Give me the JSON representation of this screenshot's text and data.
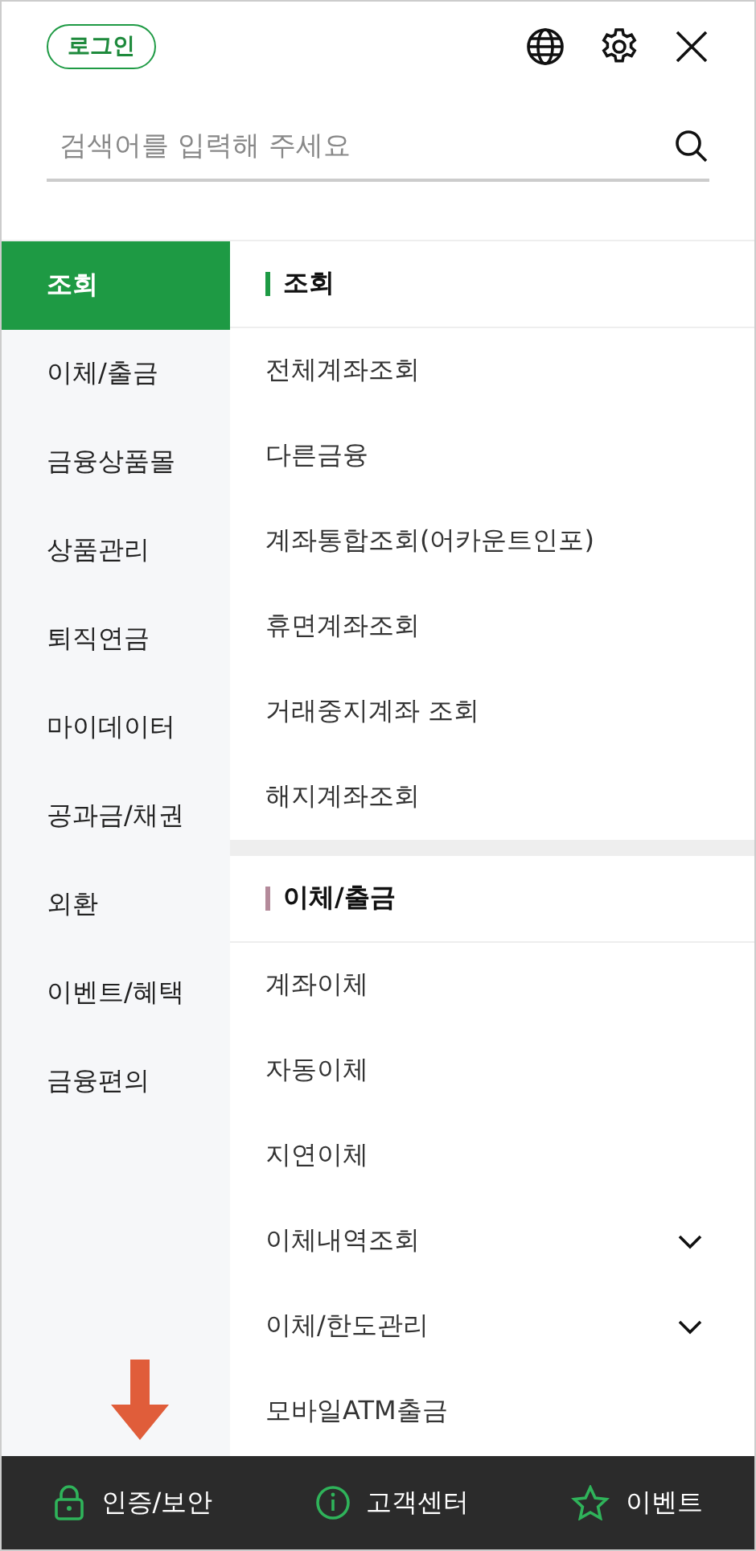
{
  "header": {
    "login_button": "로그인"
  },
  "search": {
    "placeholder": "검색어를 입력해 주세요"
  },
  "sidebar": {
    "items": [
      {
        "label": "조회",
        "selected": true
      },
      {
        "label": "이체/출금",
        "selected": false
      },
      {
        "label": "금융상품몰",
        "selected": false
      },
      {
        "label": "상품관리",
        "selected": false
      },
      {
        "label": "퇴직연금",
        "selected": false
      },
      {
        "label": "마이데이터",
        "selected": false
      },
      {
        "label": "공과금/채권",
        "selected": false
      },
      {
        "label": "외환",
        "selected": false
      },
      {
        "label": "이벤트/혜택",
        "selected": false
      },
      {
        "label": "금융편의",
        "selected": false
      }
    ]
  },
  "sections": [
    {
      "title": "조회",
      "color": "#1e9a44",
      "items": [
        {
          "label": "전체계좌조회",
          "kind": "link"
        },
        {
          "label": "다른금융",
          "kind": "link"
        },
        {
          "label": "계좌통합조회(어카운트인포)",
          "kind": "link"
        },
        {
          "label": "휴면계좌조회",
          "kind": "link"
        },
        {
          "label": "거래중지계좌 조회",
          "kind": "link"
        },
        {
          "label": "해지계좌조회",
          "kind": "link"
        }
      ]
    },
    {
      "title": "이체/출금",
      "color": "#b48a9a",
      "items": [
        {
          "label": "계좌이체",
          "kind": "link"
        },
        {
          "label": "자동이체",
          "kind": "link"
        },
        {
          "label": "지연이체",
          "kind": "link"
        },
        {
          "label": "이체내역조회",
          "kind": "expandable"
        },
        {
          "label": "이체/한도관리",
          "kind": "expandable"
        },
        {
          "label": "모바일ATM출금",
          "kind": "link"
        }
      ]
    }
  ],
  "footer": [
    {
      "label": "인증/보안",
      "kind": "lock"
    },
    {
      "label": "고객센터",
      "kind": "info"
    },
    {
      "label": "이벤트",
      "kind": "star"
    }
  ]
}
